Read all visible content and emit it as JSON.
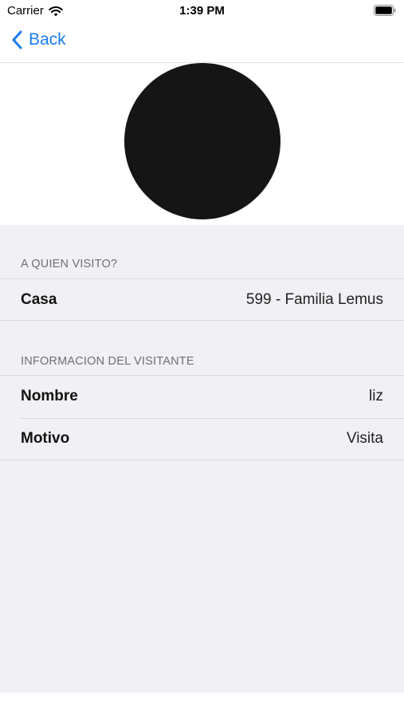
{
  "status_bar": {
    "carrier": "Carrier",
    "time": "1:39 PM",
    "wifi_icon": "wifi-icon",
    "battery_icon": "battery-icon"
  },
  "nav": {
    "back_label": "Back",
    "back_icon": "chevron-left-icon",
    "accent_color": "#1a7cf0"
  },
  "avatar": {
    "color": "#151515"
  },
  "sections": [
    {
      "header": "A QUIEN VISITO?",
      "rows": [
        {
          "label": "Casa",
          "value": "599 - Familia Lemus"
        }
      ]
    },
    {
      "header": "INFORMACION DEL VISITANTE",
      "rows": [
        {
          "label": "Nombre",
          "value": "liz"
        },
        {
          "label": "Motivo",
          "value": "Visita"
        }
      ]
    }
  ]
}
